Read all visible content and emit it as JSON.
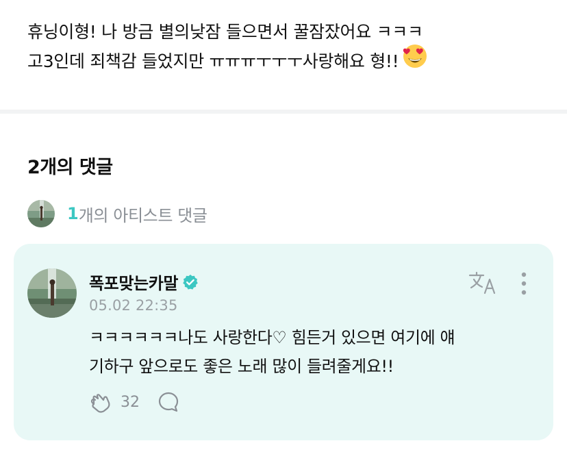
{
  "post": {
    "line1": "휴닝이형! 나 방금 별의낮잠 들으면서  꿀잠잤어요 ㅋㅋㅋ",
    "line2": "고3인데 죄책감 들었지만  ㅠㅠㅠㅜㅜㅜ사랑해요 형!!",
    "emoji_icon": "heart-eyes-emoji-icon"
  },
  "comments": {
    "title": "2개의 댓글",
    "artist_count": "1",
    "artist_label": "개의 아티스트 댓글"
  },
  "comment": {
    "author": "폭포맞는카말",
    "time": "05.02 22:35",
    "body_line1": "ㅋㅋㅋㅋㅋㅋ나도 사랑한다♡ 힘든거 있으면 여기에 얘",
    "body_line2": "기하구 앞으로도 좋은 노래 많이 들려줄게요!!",
    "like_count": "32",
    "card_color": "#e8f8f6",
    "verified_color": "#3cc7c2"
  }
}
